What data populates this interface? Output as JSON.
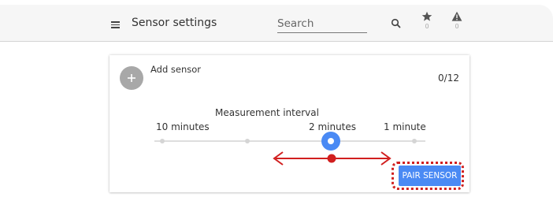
{
  "header": {
    "title": "Sensor settings",
    "search": {
      "placeholder": "Search",
      "value": ""
    },
    "favorites_count": "0",
    "alerts_count": "0"
  },
  "card": {
    "add_label": "Add sensor",
    "sensor_count": "0/12",
    "interval": {
      "label": "Measurement interval",
      "options": [
        "10 minutes",
        "2 minutes",
        "1 minute"
      ],
      "selected": "2 minutes"
    },
    "pair_button_label": "PAIR SENSOR"
  },
  "colors": {
    "accent": "#4a8af4",
    "annotation": "#d11f1f",
    "add_button": "#a8a8a8"
  },
  "icons": [
    "menu-icon",
    "search-icon",
    "star-icon",
    "warning-icon",
    "plus-icon"
  ]
}
